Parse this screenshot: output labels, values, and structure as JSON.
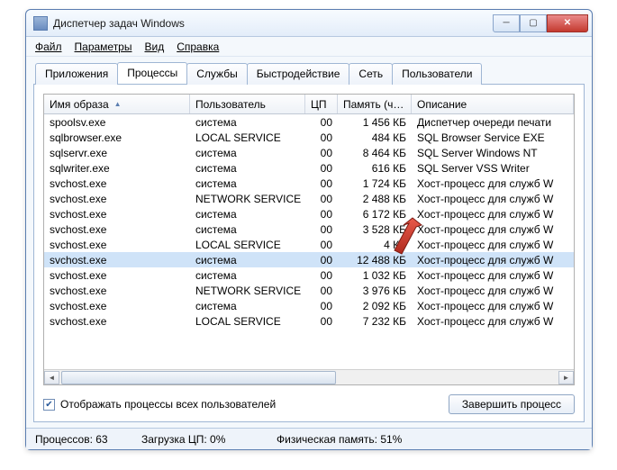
{
  "window": {
    "title": "Диспетчер задач Windows"
  },
  "menu": {
    "file": "Файл",
    "options": "Параметры",
    "view": "Вид",
    "help": "Справка"
  },
  "tabs": {
    "apps": "Приложения",
    "processes": "Процессы",
    "services": "Службы",
    "perf": "Быстродействие",
    "net": "Сеть",
    "users": "Пользователи"
  },
  "columns": {
    "image": "Имя образа",
    "user": "Пользователь",
    "cpu": "ЦП",
    "mem": "Память (ч…",
    "desc": "Описание"
  },
  "rows": [
    {
      "image": "spoolsv.exe",
      "user": "система",
      "cpu": "00",
      "mem": "1 456 КБ",
      "desc": "Диспетчер очереди печати",
      "selected": false
    },
    {
      "image": "sqlbrowser.exe",
      "user": "LOCAL SERVICE",
      "cpu": "00",
      "mem": "484 КБ",
      "desc": "SQL Browser Service EXE",
      "selected": false
    },
    {
      "image": "sqlservr.exe",
      "user": "система",
      "cpu": "00",
      "mem": "8 464 КБ",
      "desc": "SQL Server Windows NT",
      "selected": false
    },
    {
      "image": "sqlwriter.exe",
      "user": "система",
      "cpu": "00",
      "mem": "616 КБ",
      "desc": "SQL Server VSS Writer",
      "selected": false
    },
    {
      "image": "svchost.exe",
      "user": "система",
      "cpu": "00",
      "mem": "1 724 КБ",
      "desc": "Хост-процесс для служб W",
      "selected": false
    },
    {
      "image": "svchost.exe",
      "user": "NETWORK SERVICE",
      "cpu": "00",
      "mem": "2 488 КБ",
      "desc": "Хост-процесс для служб W",
      "selected": false
    },
    {
      "image": "svchost.exe",
      "user": "система",
      "cpu": "00",
      "mem": "6 172 КБ",
      "desc": "Хост-процесс для служб W",
      "selected": false
    },
    {
      "image": "svchost.exe",
      "user": "система",
      "cpu": "00",
      "mem": "3 528 КБ",
      "desc": "Хост-процесс для служб W",
      "selected": false
    },
    {
      "image": "svchost.exe",
      "user": "LOCAL SERVICE",
      "cpu": "00",
      "mem": "4      КБ",
      "desc": "Хост-процесс для служб W",
      "selected": false
    },
    {
      "image": "svchost.exe",
      "user": "система",
      "cpu": "00",
      "mem": "12 488 КБ",
      "desc": "Хост-процесс для служб W",
      "selected": true
    },
    {
      "image": "svchost.exe",
      "user": "система",
      "cpu": "00",
      "mem": "1 032 КБ",
      "desc": "Хост-процесс для служб W",
      "selected": false
    },
    {
      "image": "svchost.exe",
      "user": "NETWORK SERVICE",
      "cpu": "00",
      "mem": "3 976 КБ",
      "desc": "Хост-процесс для служб W",
      "selected": false
    },
    {
      "image": "svchost.exe",
      "user": "система",
      "cpu": "00",
      "mem": "2 092 КБ",
      "desc": "Хост-процесс для служб W",
      "selected": false
    },
    {
      "image": "svchost.exe",
      "user": "LOCAL SERVICE",
      "cpu": "00",
      "mem": "7 232 КБ",
      "desc": "Хост-процесс для служб W",
      "selected": false
    }
  ],
  "checkbox": {
    "label": "Отображать процессы всех пользователей",
    "checked": true
  },
  "button": {
    "end_process": "Завершить процесс"
  },
  "status": {
    "processes": "Процессов: 63",
    "cpu": "Загрузка ЦП: 0%",
    "mem": "Физическая память: 51%"
  }
}
